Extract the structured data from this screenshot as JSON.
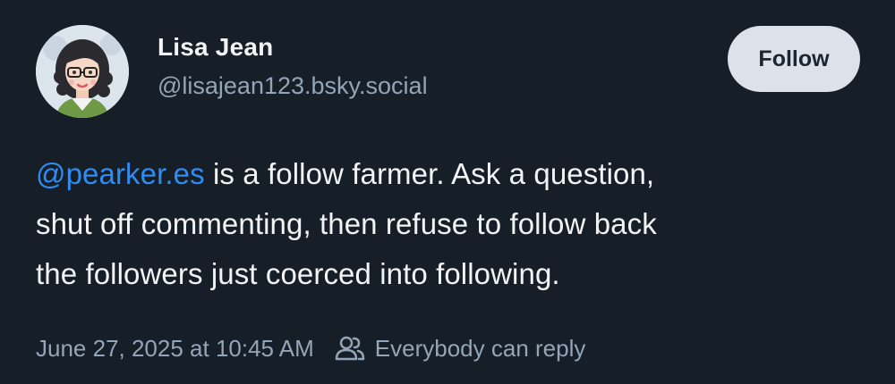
{
  "post": {
    "author": {
      "display_name": "Lisa Jean",
      "handle": "@lisajean123.bsky.social"
    },
    "follow_label": "Follow",
    "body": {
      "mention": "@pearker.es",
      "text_line1_rest": " is a follow farmer. Ask a question,",
      "text_line2": "shut off commenting, then refuse to follow back",
      "text_line3": "the followers just coerced into following."
    },
    "timestamp": "June 27, 2025 at 10:45 AM",
    "reply_setting": "Everybody can reply"
  },
  "icons": {
    "avatar": "avatar-illustration",
    "reply": "people-icon"
  },
  "colors": {
    "background": "#161e27",
    "mention": "#2f8cf3",
    "secondary_text": "#93a5b7",
    "button_bg": "#dce2ea"
  }
}
